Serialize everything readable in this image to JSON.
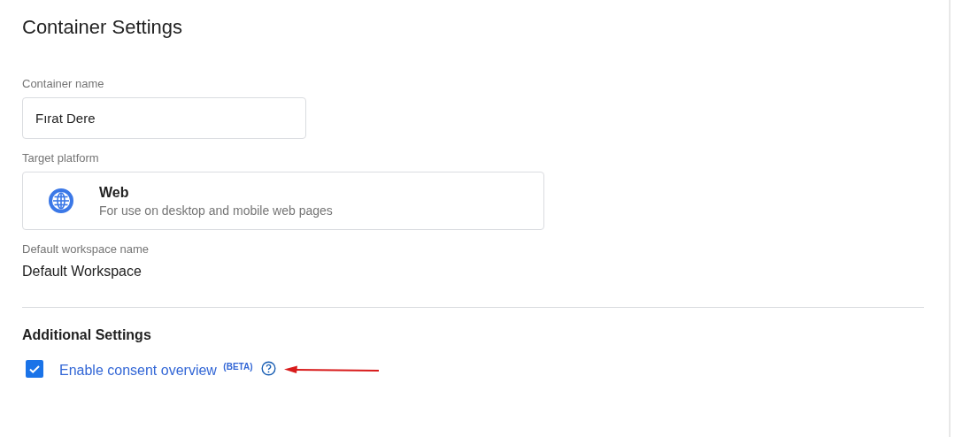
{
  "title": "Container Settings",
  "container_name": {
    "label": "Container name",
    "value": "Fırat Dere"
  },
  "target_platform": {
    "label": "Target platform",
    "name": "Web",
    "description": "For use on desktop and mobile web pages"
  },
  "default_workspace": {
    "label": "Default workspace name",
    "value": "Default Workspace"
  },
  "additional_settings": {
    "heading": "Additional Settings",
    "options": [
      {
        "label": "Enable consent overview $^{(BETA)}$",
        "checked": true
      }
    ]
  }
}
